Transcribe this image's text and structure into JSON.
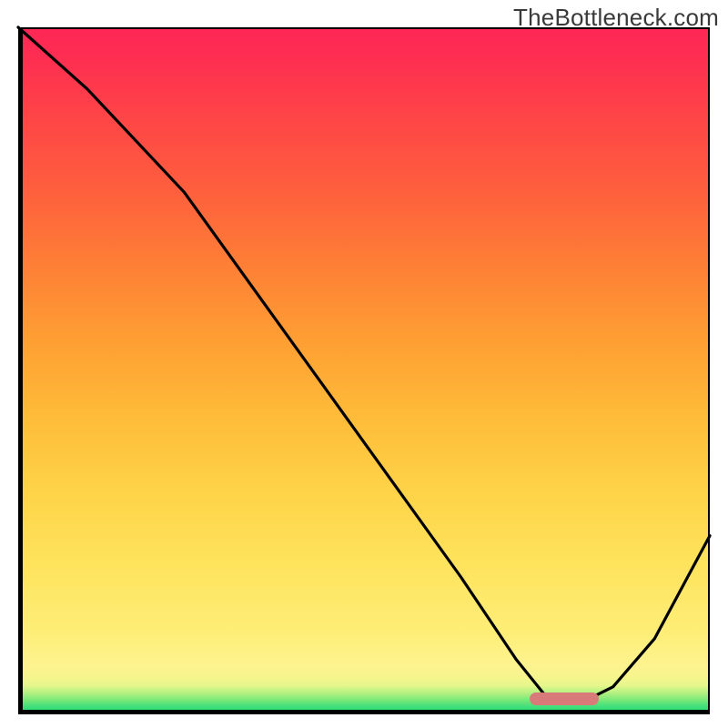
{
  "watermark": "TheBottleneck.com",
  "chart_data": {
    "type": "line",
    "title": "",
    "xlabel": "",
    "ylabel": "",
    "xlim": [
      0,
      100
    ],
    "ylim": [
      0,
      100
    ],
    "series": [
      {
        "name": "bottleneck-curve",
        "x": [
          0,
          10,
          24,
          34,
          44,
          54,
          64,
          72,
          76,
          82,
          86,
          92,
          100
        ],
        "y": [
          100,
          91,
          76,
          62,
          48,
          34,
          20,
          8,
          3,
          2,
          4,
          11,
          26
        ]
      }
    ],
    "optimal_marker": {
      "x_start": 74,
      "x_end": 84,
      "y": 2.3
    },
    "gradient_stops": [
      {
        "pos": 0.0,
        "color": "#1fd877"
      },
      {
        "pos": 0.05,
        "color": "#fdf38f"
      },
      {
        "pos": 0.5,
        "color": "#fea936"
      },
      {
        "pos": 1.0,
        "color": "#fe2656"
      }
    ]
  }
}
